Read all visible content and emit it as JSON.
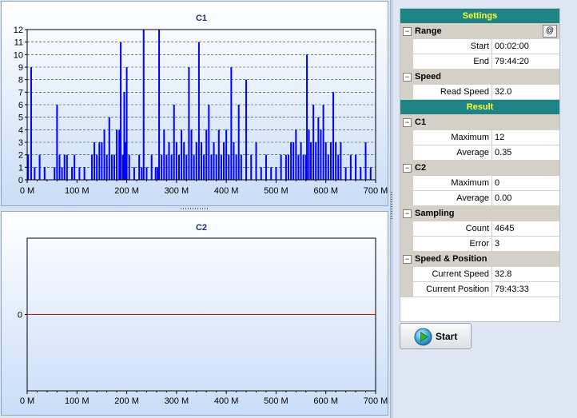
{
  "charts": {
    "c1": {
      "title": "C1",
      "ylim": [
        0,
        12
      ],
      "yticks": [
        "0",
        "1",
        "2",
        "3",
        "4",
        "5",
        "6",
        "7",
        "8",
        "9",
        "10",
        "11",
        "12"
      ],
      "xticks": [
        "0 M",
        "100 M",
        "200 M",
        "300 M",
        "400 M",
        "500 M",
        "600 M",
        "700 M"
      ]
    },
    "c2": {
      "title": "C2",
      "yticks": [
        "0"
      ],
      "xticks": [
        "0 M",
        "100 M",
        "200 M",
        "300 M",
        "400 M",
        "500 M",
        "600 M",
        "700 M"
      ]
    }
  },
  "chart_data": [
    {
      "type": "bar",
      "title": "C1",
      "xlim": [
        0,
        700
      ],
      "ylim": [
        0,
        12
      ],
      "x_unit": "M",
      "grid": true,
      "series": [
        {
          "color": "#0000ff",
          "x": [
            2,
            8,
            15,
            25,
            35,
            55,
            60,
            65,
            70,
            75,
            80,
            90,
            95,
            105,
            115,
            130,
            135,
            140,
            145,
            150,
            155,
            160,
            165,
            170,
            175,
            180,
            185,
            188,
            192,
            195,
            198,
            200,
            205,
            215,
            225,
            230,
            234,
            240,
            250,
            258,
            262,
            265,
            270,
            275,
            280,
            285,
            290,
            295,
            300,
            305,
            310,
            315,
            320,
            325,
            330,
            335,
            340,
            345,
            350,
            355,
            360,
            365,
            370,
            375,
            380,
            385,
            390,
            395,
            400,
            405,
            410,
            415,
            420,
            425,
            430,
            440,
            450,
            460,
            470,
            480,
            490,
            500,
            510,
            520,
            525,
            530,
            535,
            540,
            545,
            550,
            555,
            560,
            562,
            566,
            570,
            575,
            580,
            585,
            590,
            595,
            600,
            605,
            610,
            615,
            620,
            625,
            630,
            640,
            650,
            660,
            670,
            680,
            690
          ],
          "y": [
            2,
            9,
            1,
            2,
            1,
            1,
            6,
            2,
            1,
            2,
            2,
            1,
            2,
            1,
            1,
            2,
            3,
            2,
            3,
            3,
            4,
            2,
            5,
            2,
            2,
            4,
            4,
            11,
            2,
            7,
            3,
            9,
            2,
            1,
            2,
            1,
            12,
            1,
            2,
            1,
            1,
            12,
            2,
            4,
            2,
            3,
            2,
            6,
            3,
            2,
            4,
            3,
            2,
            9,
            4,
            2,
            3,
            11,
            3,
            2,
            4,
            6,
            2,
            3,
            2,
            4,
            2,
            3,
            4,
            2,
            9,
            3,
            2,
            6,
            2,
            8,
            2,
            3,
            1,
            2,
            1,
            1,
            2,
            2,
            2,
            3,
            3,
            4,
            2,
            3,
            2,
            2,
            10,
            4,
            3,
            6,
            3,
            5,
            4,
            6,
            3,
            2,
            3,
            7,
            3,
            2,
            3,
            1,
            2,
            2,
            1,
            3,
            1
          ]
        }
      ]
    },
    {
      "type": "line",
      "title": "C2",
      "xlim": [
        0,
        700
      ],
      "x_unit": "M",
      "series": [
        {
          "color": "#ff0000",
          "x": [
            0,
            700
          ],
          "y": [
            0,
            0
          ]
        }
      ]
    }
  ],
  "settings_header": "Settings",
  "range": {
    "label": "Range",
    "at_button": "@",
    "start_label": "Start",
    "start_value": "00:02:00",
    "end_label": "End",
    "end_value": "79:44:20"
  },
  "speed": {
    "label": "Speed",
    "read_speed_label": "Read Speed",
    "read_speed_value": "32.0"
  },
  "result_header": "Result",
  "c1_result": {
    "label": "C1",
    "max_label": "Maximum",
    "max_value": "12",
    "avg_label": "Average",
    "avg_value": "0.35"
  },
  "c2_result": {
    "label": "C2",
    "max_label": "Maximum",
    "max_value": "0",
    "avg_label": "Average",
    "avg_value": "0.00"
  },
  "sampling": {
    "label": "Sampling",
    "count_label": "Count",
    "count_value": "4645",
    "error_label": "Error",
    "error_value": "3"
  },
  "speed_position": {
    "label": "Speed & Position",
    "current_speed_label": "Current Speed",
    "current_speed_value": "32.8",
    "current_position_label": "Current Position",
    "current_position_value": "79:43:33"
  },
  "start_button": {
    "label": "Start",
    "icon": "play-icon"
  },
  "colors": {
    "section_bg": "#1e8385",
    "section_text": "#ffff33",
    "c1_bar": "#0000ff",
    "c2_line": "#ff0000"
  }
}
